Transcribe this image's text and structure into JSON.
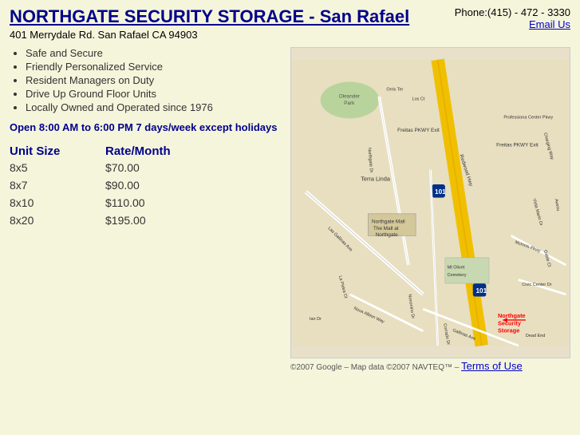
{
  "header": {
    "title": "NORTHGATE SECURITY STORAGE - San Rafael",
    "address": "401 Merrydale Rd. San Rafael CA 94903",
    "phone": "Phone:(415) - 472 - 3330",
    "email_label": "Email Us"
  },
  "features": [
    "Safe and Secure",
    "Friendly Personalized Service",
    "Resident Managers on Duty",
    "Drive Up Ground Floor Units",
    "Locally Owned and Operated since 1976"
  ],
  "hours": "Open 8:00 AM to 6:00 PM 7 days/week except holidays",
  "pricing": {
    "col_unit": "Unit Size",
    "col_rate": "Rate/Month",
    "rows": [
      {
        "size": "8x5",
        "rate": "$70.00"
      },
      {
        "size": "8x7",
        "rate": "$90.00"
      },
      {
        "size": "8x10",
        "rate": "$110.00"
      },
      {
        "size": "8x20",
        "rate": "$195.00"
      }
    ]
  },
  "map": {
    "copyright": "©2007 Google – Map data ©2007 NAVTEQ™ –",
    "terms_label": "Terms of Use",
    "label": "Northgate Security Storage"
  }
}
